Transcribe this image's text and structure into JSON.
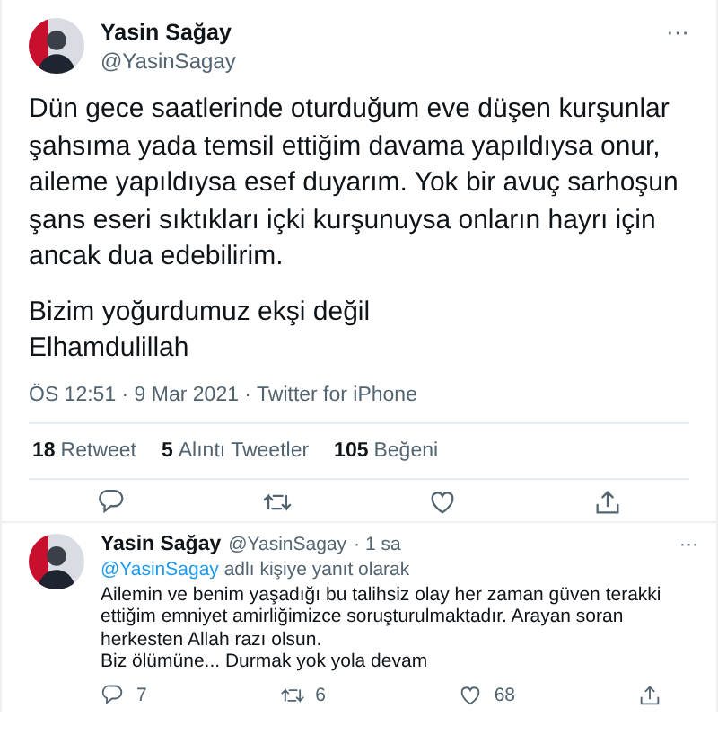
{
  "tweet": {
    "author": {
      "name": "Yasin Sağay",
      "handle": "@YasinSagay"
    },
    "more": "···",
    "paragraphs": [
      "Dün gece saatlerinde oturduğum eve düşen kurşunlar şahsıma yada temsil ettiğim davama yapıldıysa onur, aileme yapıldıysa esef duyarım. Yok bir avuç sarhoşun şans eseri sıktıkları içki kurşunuysa onların hayrı için ancak dua edebilirim.",
      "Bizim yoğurdumuz ekşi değil\nElhamdulillah"
    ],
    "meta": "ÖS 12:51 · 9 Mar 2021 · Twitter for iPhone",
    "stats": [
      {
        "count": "18",
        "label": "Retweet"
      },
      {
        "count": "5",
        "label": "Alıntı Tweetler"
      },
      {
        "count": "105",
        "label": "Beğeni"
      }
    ],
    "actions": [
      {
        "kind": "reply"
      },
      {
        "kind": "retweet"
      },
      {
        "kind": "like"
      },
      {
        "kind": "share"
      }
    ]
  },
  "reply": {
    "author": {
      "name": "Yasin Sağay",
      "handle": "@YasinSagay"
    },
    "time": "· 1 sa",
    "more": "···",
    "replying_to": {
      "mention": "@YasinSagay",
      "text": "adlı kişiye yanıt olarak"
    },
    "text": "Ailemin ve benim yaşadığı bu talihsiz olay her zaman güven terakki ettiğim emniyet amirliğimizce soruşturulmaktadır. Arayan soran herkesten Allah razı olsun.\nBiz ölümüne... Durmak yok yola devam",
    "actions": [
      {
        "kind": "reply",
        "count": "7"
      },
      {
        "kind": "retweet",
        "count": "6"
      },
      {
        "kind": "like",
        "count": "68"
      },
      {
        "kind": "share"
      }
    ]
  }
}
